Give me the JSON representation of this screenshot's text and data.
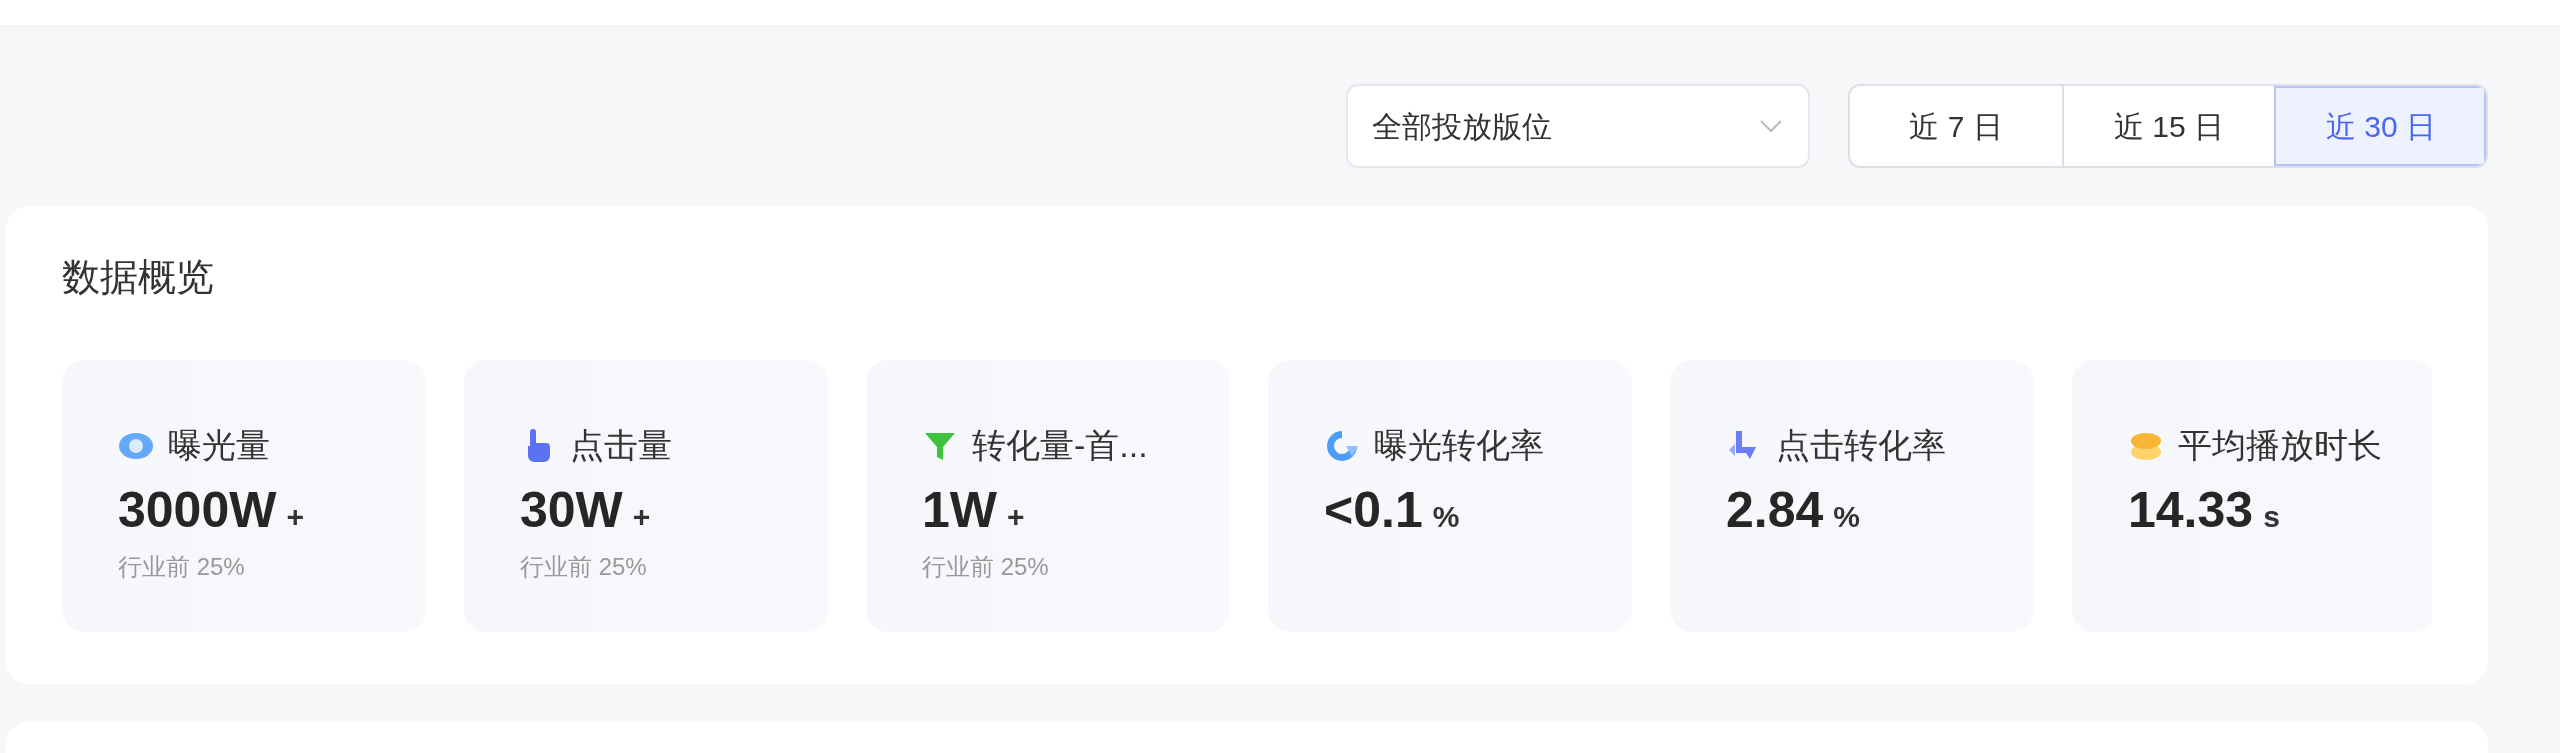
{
  "filter": {
    "placement": {
      "value": "全部投放版位"
    },
    "ranges": [
      {
        "label": "近 7 日",
        "selected": false
      },
      {
        "label": "近 15 日",
        "selected": false
      },
      {
        "label": "近 30 日",
        "selected": true
      }
    ]
  },
  "overview": {
    "title": "数据概览",
    "metrics": [
      {
        "label": "曝光量",
        "value": "3000W",
        "unit": "+",
        "note": "行业前 25%"
      },
      {
        "label": "点击量",
        "value": "30W",
        "unit": "+",
        "note": "行业前 25%"
      },
      {
        "label": "转化量-首...",
        "value": "1W",
        "unit": "+",
        "note": "行业前 25%"
      },
      {
        "label": "曝光转化率",
        "value": "<0.1",
        "unit": "%"
      },
      {
        "label": "点击转化率",
        "value": "2.84",
        "unit": "%"
      },
      {
        "label": "平均播放时长",
        "value": "14.33",
        "unit": "s"
      }
    ]
  }
}
